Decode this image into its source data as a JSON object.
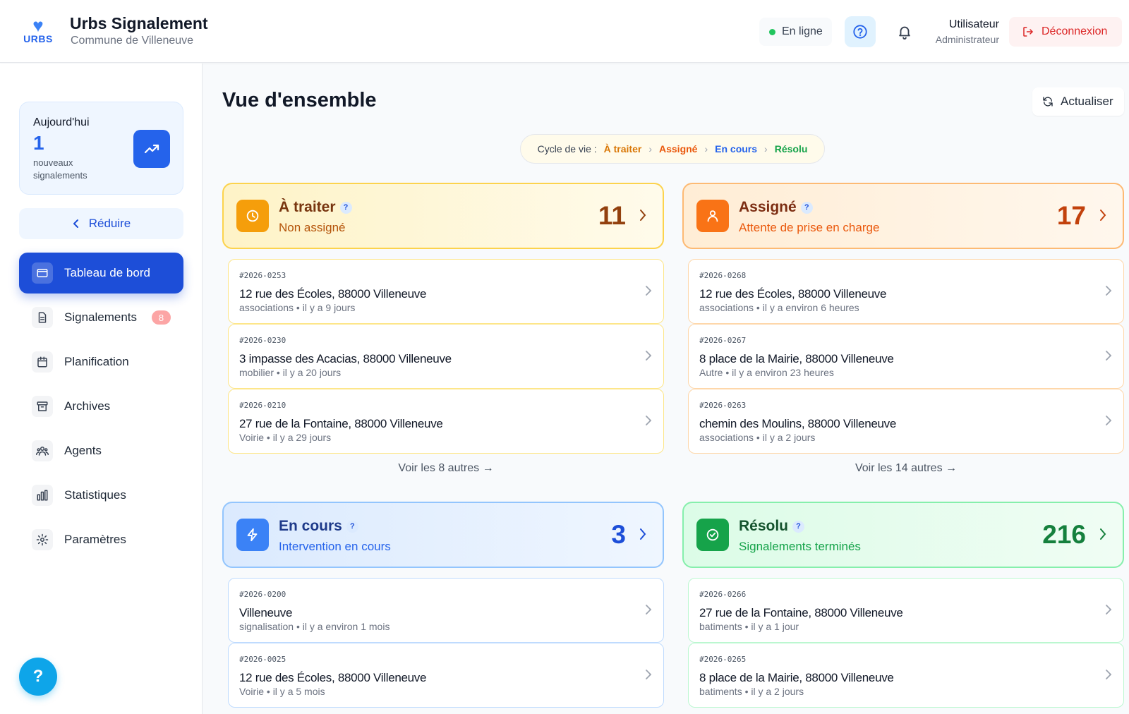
{
  "app": {
    "logo_text": "URBS",
    "title": "Urbs Signalement",
    "subtitle": "Commune de Villeneuve"
  },
  "header": {
    "status": "En ligne",
    "user_name": "Utilisateur",
    "user_role": "Administrateur",
    "logout_label": "Déconnexion"
  },
  "sidebar": {
    "today_label": "Aujourd'hui",
    "today_value": "1",
    "today_desc": "nouveaux signalements",
    "collapse_label": "Réduire",
    "nav": [
      {
        "label": "Tableau de bord",
        "icon": "folder-icon",
        "active": true
      },
      {
        "label": "Signalements",
        "icon": "document-icon",
        "badge": "8"
      },
      {
        "label": "Planification",
        "icon": "calendar-icon"
      },
      {
        "label": "Archives",
        "icon": "archive-icon"
      },
      {
        "label": "Agents",
        "icon": "users-icon"
      },
      {
        "label": "Statistiques",
        "icon": "bar-chart-icon"
      },
      {
        "label": "Paramètres",
        "icon": "gear-icon"
      }
    ],
    "help_label": "?"
  },
  "main": {
    "title": "Vue d'ensemble",
    "refresh_label": "Actualiser",
    "lifecycle": {
      "label": "Cycle de vie :",
      "steps": [
        "À traiter",
        "Assigné",
        "En cours",
        "Résolu"
      ]
    },
    "panels": [
      {
        "title": "À traiter",
        "subtitle": "Non assigné",
        "count": "11",
        "q": "?",
        "more": "Voir les 8 autres →",
        "items": [
          {
            "id": "#2026-0253",
            "address": "12 rue des Écoles, 88000 Villeneuve",
            "meta": "associations • il y a 9 jours"
          },
          {
            "id": "#2026-0230",
            "address": "3 impasse des Acacias, 88000 Villeneuve",
            "meta": "mobilier • il y a 20 jours"
          },
          {
            "id": "#2026-0210",
            "address": "27 rue de la Fontaine, 88000 Villeneuve",
            "meta": "Voirie • il y a 29 jours"
          }
        ]
      },
      {
        "title": "Assigné",
        "subtitle": "Attente de prise en charge",
        "count": "17",
        "q": "?",
        "more": "Voir les 14 autres →",
        "items": [
          {
            "id": "#2026-0268",
            "address": "12 rue des Écoles, 88000 Villeneuve",
            "meta": "associations • il y a environ 6 heures"
          },
          {
            "id": "#2026-0267",
            "address": "8 place de la Mairie, 88000 Villeneuve",
            "meta": "Autre • il y a environ 23 heures"
          },
          {
            "id": "#2026-0263",
            "address": "chemin des Moulins, 88000 Villeneuve",
            "meta": "associations • il y a 2 jours"
          }
        ]
      },
      {
        "title": "En cours",
        "subtitle": "Intervention en cours",
        "count": "3",
        "q": "?",
        "items": [
          {
            "id": "#2026-0200",
            "address": "Villeneuve",
            "meta": "signalisation • il y a environ 1 mois"
          },
          {
            "id": "#2026-0025",
            "address": "12 rue des Écoles, 88000 Villeneuve",
            "meta": "Voirie • il y a 5 mois"
          }
        ]
      },
      {
        "title": "Résolu",
        "subtitle": "Signalements terminés",
        "count": "216",
        "q": "?",
        "items": [
          {
            "id": "#2026-0266",
            "address": "27 rue de la Fontaine, 88000 Villeneuve",
            "meta": "batiments • il y a 1 jour"
          },
          {
            "id": "#2026-0265",
            "address": "8 place de la Mairie, 88000 Villeneuve",
            "meta": "batiments • il y a 2 jours"
          }
        ]
      }
    ]
  },
  "colors": {
    "primary": "#1d4ed8",
    "a_traiter": "#d97706",
    "assigne": "#ea580c",
    "en_cours": "#2563eb",
    "resolu": "#16a34a",
    "danger": "#dc2626"
  }
}
